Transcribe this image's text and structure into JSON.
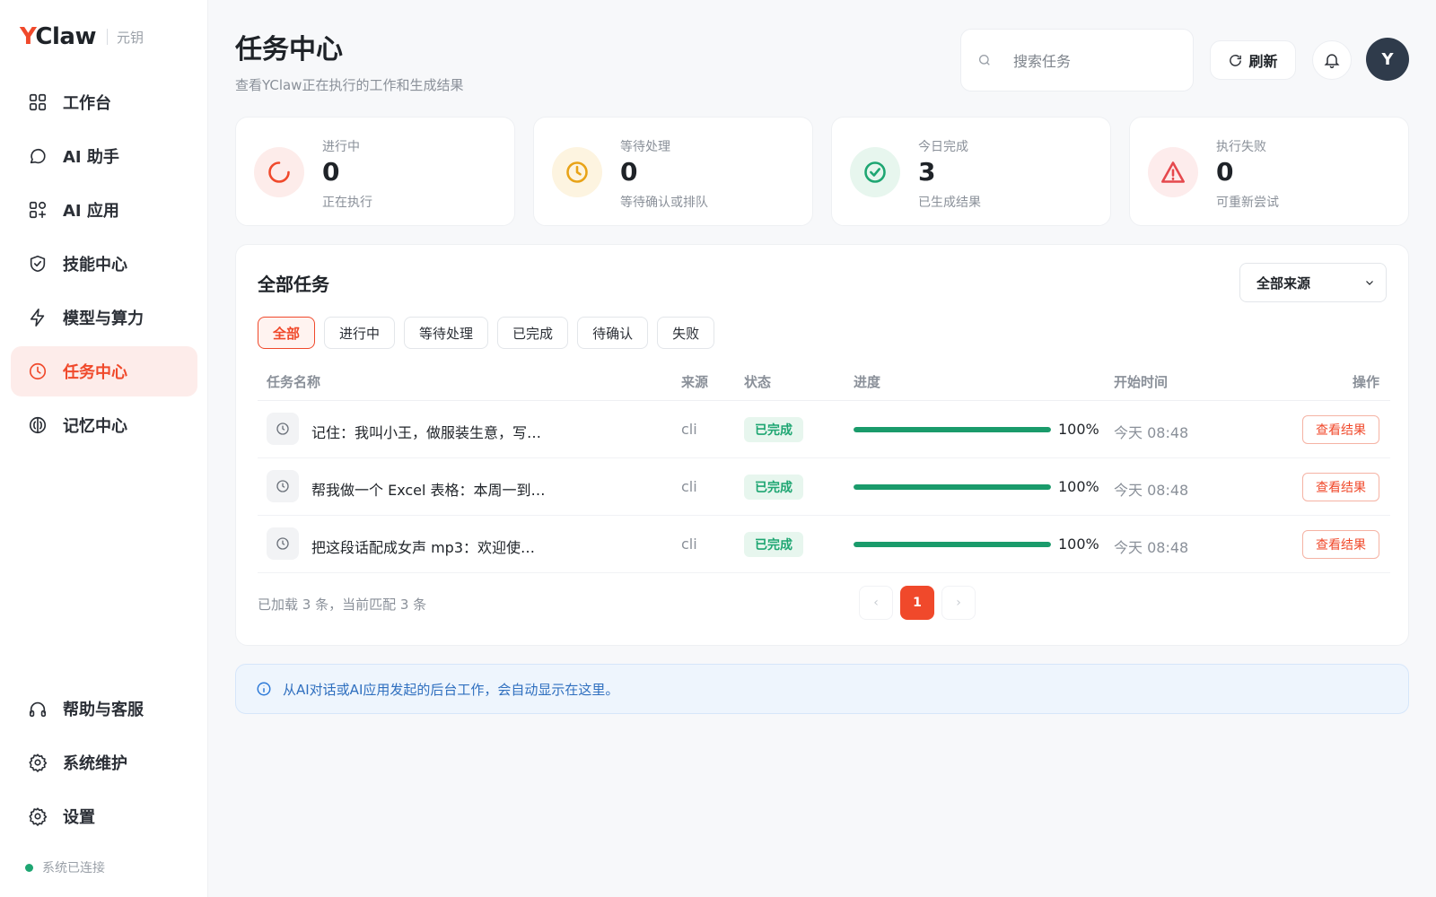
{
  "brand": {
    "name_y": "Y",
    "name_rest": "Claw",
    "sub": "元钥"
  },
  "sidebar": {
    "items": [
      {
        "label": "工作台",
        "icon": "grid-icon"
      },
      {
        "label": "AI 助手",
        "icon": "chat-bubble-icon"
      },
      {
        "label": "AI 应用",
        "icon": "apps-icon"
      },
      {
        "label": "技能中心",
        "icon": "shield-check-icon"
      },
      {
        "label": "模型与算力",
        "icon": "bolt-icon"
      },
      {
        "label": "任务中心",
        "icon": "clock-icon",
        "active": true
      },
      {
        "label": "记忆中心",
        "icon": "memory-icon"
      }
    ],
    "bottom_items": [
      {
        "label": "帮助与客服",
        "icon": "headphones-icon"
      },
      {
        "label": "系统维护",
        "icon": "gear-icon"
      },
      {
        "label": "设置",
        "icon": "gear-icon"
      }
    ],
    "status": "系统已连接"
  },
  "header": {
    "title": "任务中心",
    "subtitle": "查看YClaw正在执行的工作和生成结果",
    "search_placeholder": "搜索任务",
    "refresh_label": "刷新",
    "avatar_letter": "Y"
  },
  "stats": [
    {
      "label": "进行中",
      "value": "0",
      "sub": "正在执行",
      "icon": "spinner-icon",
      "color": "#f0492b",
      "bg": "#fdecea"
    },
    {
      "label": "等待处理",
      "value": "0",
      "sub": "等待确认或排队",
      "icon": "clock-icon",
      "color": "#e8a317",
      "bg": "#fdf4e0"
    },
    {
      "label": "今日完成",
      "value": "3",
      "sub": "已生成结果",
      "icon": "check-circle-icon",
      "color": "#1ea672",
      "bg": "#e7f6ee"
    },
    {
      "label": "执行失败",
      "value": "0",
      "sub": "可重新尝试",
      "icon": "warning-icon",
      "color": "#e5484d",
      "bg": "#fdecec"
    }
  ],
  "tasks": {
    "title": "全部任务",
    "source_select": "全部来源",
    "filters": [
      "全部",
      "进行中",
      "等待处理",
      "已完成",
      "待确认",
      "失败"
    ],
    "active_filter": "全部",
    "columns": [
      "任务名称",
      "来源",
      "状态",
      "进度",
      "开始时间",
      "操作"
    ],
    "rows": [
      {
        "name": "记住：我叫小王，做服装生意，写…",
        "source": "cli",
        "status": "已完成",
        "progress": 100,
        "progress_label": "100%",
        "time": "今天 08:48",
        "action": "查看结果"
      },
      {
        "name": "帮我做一个 Excel 表格：本周一到…",
        "source": "cli",
        "status": "已完成",
        "progress": 100,
        "progress_label": "100%",
        "time": "今天 08:48",
        "action": "查看结果"
      },
      {
        "name": "把这段话配成女声 mp3：欢迎使…",
        "source": "cli",
        "status": "已完成",
        "progress": 100,
        "progress_label": "100%",
        "time": "今天 08:48",
        "action": "查看结果"
      }
    ],
    "loaded_text": "已加载 3 条，当前匹配 3 条",
    "pager": {
      "prev": "‹",
      "current": "1",
      "next": "›"
    }
  },
  "info": {
    "text": "从AI对话或AI应用发起的后台工作，会自动显示在这里。"
  }
}
